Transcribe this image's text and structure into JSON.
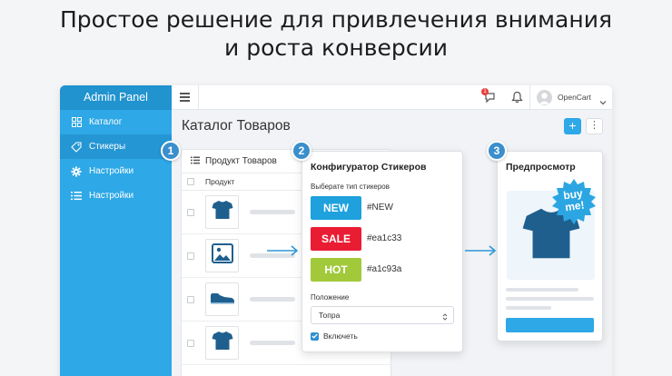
{
  "headline": {
    "line1": "Простое решение для привлечения внимания",
    "line2": "и роста конверсии"
  },
  "sidebar": {
    "title": "Admin Panel",
    "items": [
      {
        "label": "Каталог",
        "icon": "grid-icon"
      },
      {
        "label": "Стикеры",
        "icon": "tag-icon",
        "active": true
      },
      {
        "label": "Настройки",
        "icon": "gear-icon"
      },
      {
        "label": "Настройки",
        "icon": "list-icon"
      }
    ]
  },
  "topbar": {
    "notification_count": "1",
    "user_name": "OpenCart"
  },
  "page": {
    "title": "Каталог Товаров",
    "add_label": "+",
    "more_label": "⋮"
  },
  "product_card": {
    "title": "Продукт Товаров",
    "column_header": "Продукт",
    "rows": [
      {
        "thumb": "tshirt-icon"
      },
      {
        "thumb": "image-icon"
      },
      {
        "thumb": "sneaker-icon"
      },
      {
        "thumb": "tshirt-icon"
      }
    ]
  },
  "configurator": {
    "title": "Конфигуратор Стикеров",
    "type_label": "Выберате тип стикеров",
    "stickers": [
      {
        "label": "NEW",
        "code": "#NEW",
        "color": "#1ea1dd"
      },
      {
        "label": "SALE",
        "code": "#ea1c33",
        "color": "#ea1c33"
      },
      {
        "label": "HOT",
        "code": "#a1c93a",
        "color": "#a1c93a"
      }
    ],
    "position_label": "Положение",
    "position_value": "Топра",
    "enable_label": "Включеть"
  },
  "preview": {
    "title": "Предпросмотр",
    "badge_line1": "buy",
    "badge_line2": "me!"
  },
  "steps": [
    "1",
    "2",
    "3"
  ],
  "colors": {
    "sidebar": "#2ea8e6",
    "sidebar_header": "#2193cf",
    "step": "#3b8fcc",
    "accent": "#2ea8e6"
  }
}
